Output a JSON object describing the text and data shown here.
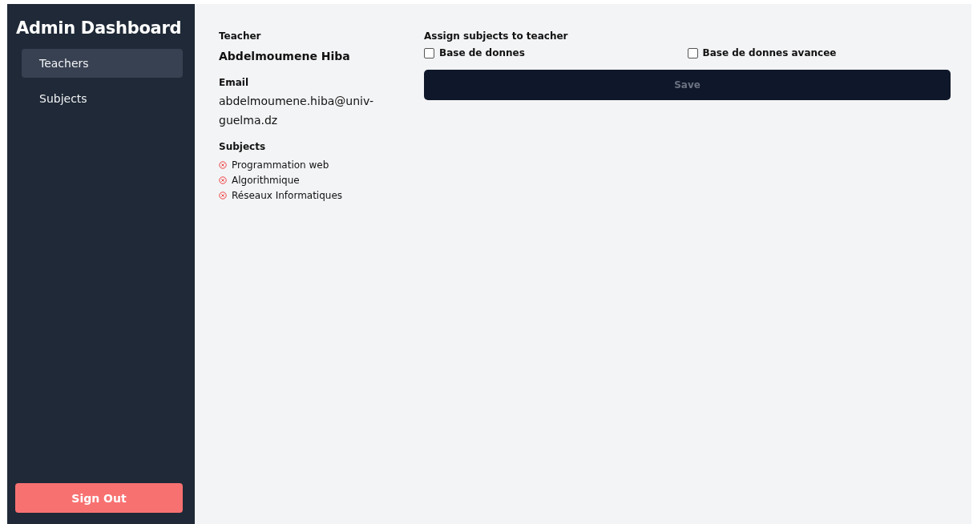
{
  "sidebar": {
    "title": "Admin Dashboard",
    "items": [
      {
        "label": "Teachers",
        "selected": true
      },
      {
        "label": "Subjects",
        "selected": false
      }
    ],
    "sign_out": "Sign Out"
  },
  "teacher": {
    "teacher_label": "Teacher",
    "name": "Abdelmoumene Hiba",
    "email_label": "Email",
    "email": "abdelmoumene.hiba@univ-guelma.dz",
    "subjects_label": "Subjects",
    "subjects": [
      "Programmation web",
      "Algorithmique",
      "Réseaux Informatiques"
    ]
  },
  "assign": {
    "label": "Assign subjects to teacher",
    "options": [
      {
        "label": "Base de donnes",
        "checked": false
      },
      {
        "label": "Base de donnes avancee",
        "checked": false
      }
    ],
    "save": "Save"
  }
}
